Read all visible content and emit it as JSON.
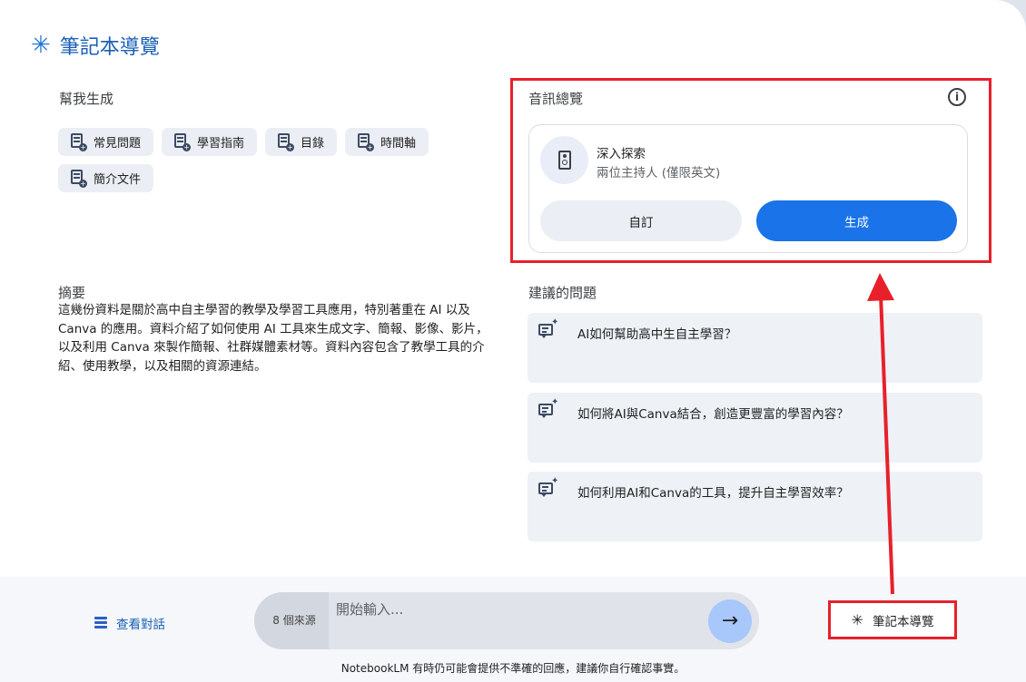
{
  "header": {
    "title": "筆記本導覽"
  },
  "help": {
    "title": "幫我生成",
    "chips": [
      {
        "label": "常見問題",
        "icon": "document-add-icon"
      },
      {
        "label": "學習指南",
        "icon": "document-add-icon"
      },
      {
        "label": "目錄",
        "icon": "document-add-icon"
      },
      {
        "label": "時間軸",
        "icon": "document-add-icon"
      },
      {
        "label": "簡介文件",
        "icon": "document-add-icon"
      }
    ]
  },
  "summary": {
    "title": "摘要",
    "text": "這幾份資料是關於高中自主學習的教學及學習工具應用，特別著重在 AI 以及 Canva 的應用。資料介紹了如何使用 AI 工具來生成文字、簡報、影像、影片，以及利用 Canva 來製作簡報、社群媒體素材等。資料內容包含了教學工具的介紹、使用教學，以及相關的資源連結。"
  },
  "audio": {
    "title": "音訊總覽",
    "info_icon": "info-icon",
    "deep_dive_title": "深入探索",
    "deep_dive_sub": "兩位主持人 (僅限英文)",
    "custom_label": "自訂",
    "generate_label": "生成"
  },
  "suggested": {
    "title": "建議的問題",
    "questions": [
      "AI如何幫助高中生自主學習？",
      "如何將AI與Canva結合，創造更豐富的學習內容？",
      "如何利用AI和Canva的工具，提升自主學習效率？"
    ]
  },
  "bottom": {
    "view_chat_label": "查看對話",
    "sources_label": "8 個來源",
    "input_placeholder": "開始輸入...",
    "send_icon": "arrow-right-icon",
    "guide_label": "筆記本導覽",
    "disclaimer": "NotebookLM 有時仍可能會提供不準確的回應，建議你自行確認事實。"
  },
  "colors": {
    "accent": "#1a73e8",
    "highlight": "#e8202a",
    "title_blue": "#1a5fb4"
  }
}
